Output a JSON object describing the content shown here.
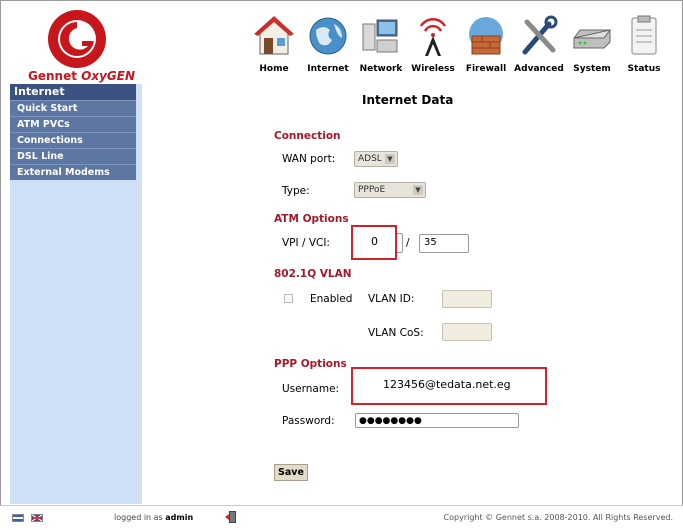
{
  "brand": {
    "name_part1": "Gennet ",
    "name_part2": "OxyGEN"
  },
  "nav": [
    {
      "label": "Home",
      "icon": "home-icon"
    },
    {
      "label": "Internet",
      "icon": "globe-icon"
    },
    {
      "label": "Network",
      "icon": "network-icon"
    },
    {
      "label": "Wireless",
      "icon": "wireless-tower-icon"
    },
    {
      "label": "Firewall",
      "icon": "firewall-icon"
    },
    {
      "label": "Advanced",
      "icon": "tools-icon"
    },
    {
      "label": "System",
      "icon": "router-icon"
    },
    {
      "label": "Status",
      "icon": "clipboard-icon"
    }
  ],
  "sidebar": {
    "header": "Internet",
    "items": [
      "Quick Start",
      "ATM PVCs",
      "Connections",
      "DSL Line",
      "External Modems"
    ]
  },
  "page_title": "Internet Data",
  "connection": {
    "heading": "Connection",
    "wan_port_label": "WAN port:",
    "wan_port_value": "ADSL",
    "type_label": "Type:",
    "type_value": "PPPoE"
  },
  "atm": {
    "heading": "ATM Options",
    "vpi_vci_label": "VPI / VCI:",
    "vpi_value": "0",
    "separator": "/",
    "vci_value": "35"
  },
  "vlan": {
    "heading": "802.1Q VLAN",
    "enabled_label": "Enabled",
    "vlan_id_label": "VLAN ID:",
    "vlan_cos_label": "VLAN CoS:"
  },
  "ppp": {
    "heading": "PPP Options",
    "username_label": "Username:",
    "username_value": "123456@tedata.net.eg",
    "password_label": "Password:",
    "password_value": "●●●●●●●●"
  },
  "save_label": "Save",
  "footer": {
    "logged_prefix": "logged in as ",
    "user": "admin",
    "copyright": "Copyright © Gennet s.a. 2008-2010. All Rights Reserved."
  },
  "colors": {
    "brand_red": "#c8161d",
    "section_red": "#a4182a",
    "sidebar_bg": "#cfe0f6",
    "sidebar_header": "#3c5280",
    "sidebar_item": "#5d77a3",
    "highlight_red": "#d2232a"
  }
}
